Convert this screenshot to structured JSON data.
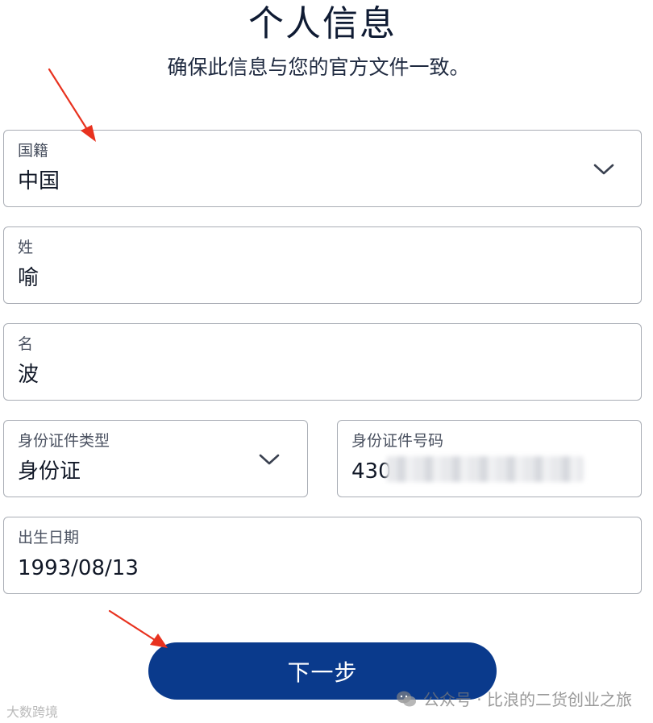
{
  "header": {
    "title": "个人信息",
    "subtitle": "确保此信息与您的官方文件一致。"
  },
  "form": {
    "nationality": {
      "label": "国籍",
      "value": "中国"
    },
    "last_name": {
      "label": "姓",
      "value": "喻"
    },
    "first_name": {
      "label": "名",
      "value": "波"
    },
    "id_type": {
      "label": "身份证件类型",
      "value": "身份证"
    },
    "id_number": {
      "label": "身份证件号码",
      "value": "430"
    },
    "birth_date": {
      "label": "出生日期",
      "value": "1993/08/13"
    }
  },
  "actions": {
    "next_label": "下一步"
  },
  "watermarks": {
    "right": "公众号 · 比浪的二货创业之旅",
    "left": "大数跨境"
  },
  "colors": {
    "primary_button": "#0a3a8c",
    "annotation_arrow": "#e8321f",
    "field_border": "#a9adb5"
  },
  "icons": {
    "select_chevron": "chevron-down-icon",
    "annotation": "red-arrow-icon",
    "wechat": "wechat-icon"
  }
}
